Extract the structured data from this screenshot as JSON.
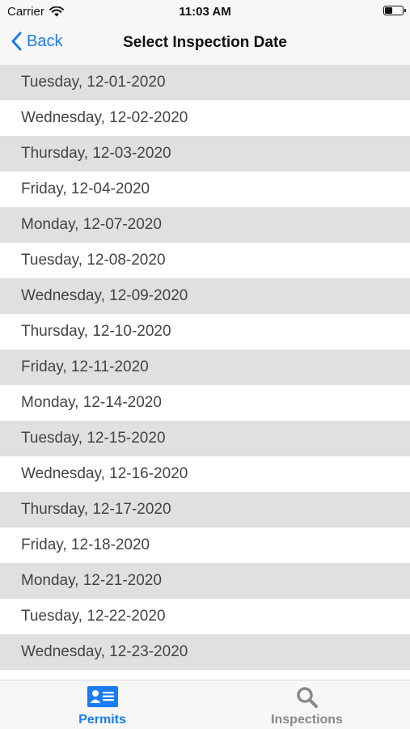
{
  "status_bar": {
    "carrier": "Carrier",
    "time": "11:03 AM"
  },
  "nav": {
    "back_label": "Back",
    "title": "Select Inspection Date"
  },
  "dates": [
    "Tuesday, 12-01-2020",
    "Wednesday, 12-02-2020",
    "Thursday, 12-03-2020",
    "Friday, 12-04-2020",
    "Monday, 12-07-2020",
    "Tuesday, 12-08-2020",
    "Wednesday, 12-09-2020",
    "Thursday, 12-10-2020",
    "Friday, 12-11-2020",
    "Monday, 12-14-2020",
    "Tuesday, 12-15-2020",
    "Wednesday, 12-16-2020",
    "Thursday, 12-17-2020",
    "Friday, 12-18-2020",
    "Monday, 12-21-2020",
    "Tuesday, 12-22-2020",
    "Wednesday, 12-23-2020"
  ],
  "tabs": [
    {
      "label": "Permits",
      "icon": "id-card-icon",
      "active": true
    },
    {
      "label": "Inspections",
      "icon": "search-icon",
      "active": false
    }
  ],
  "colors": {
    "accent": "#1a7cf5",
    "row_alt": "#e0e0e0",
    "inactive_tab": "#8a8a8a"
  }
}
